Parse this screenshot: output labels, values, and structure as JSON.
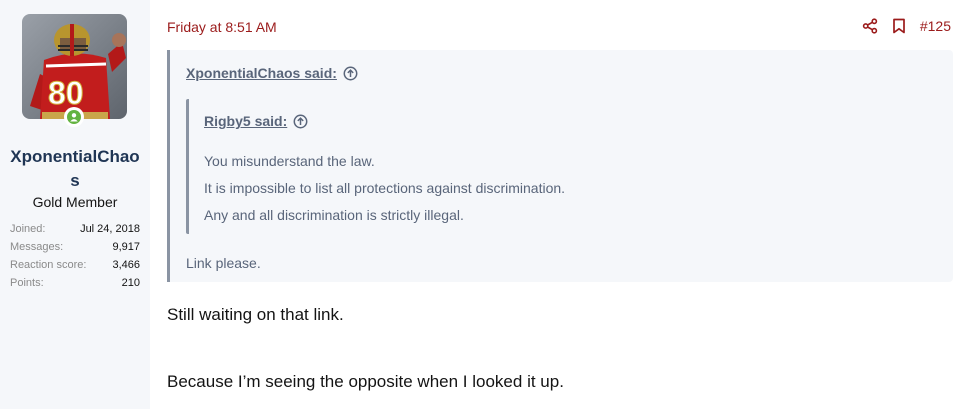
{
  "user": {
    "name": "XponentialChaos",
    "title": "Gold Member",
    "stats": [
      {
        "label": "Joined:",
        "value": "Jul 24, 2018"
      },
      {
        "label": "Messages:",
        "value": "9,917"
      },
      {
        "label": "Reaction score:",
        "value": "3,466"
      },
      {
        "label": "Points:",
        "value": "210"
      }
    ],
    "online_color": "#63b340"
  },
  "post": {
    "date": "Friday at 8:51 AM",
    "number": "#125",
    "accent_color": "#9b1b1b",
    "outer_quote": {
      "author_said": "XponentialChaos said:",
      "inner_quote": {
        "author_said": "Rigby5 said:",
        "lines": [
          "You misunderstand the law.",
          "It is impossible to list all protections against discrimination.",
          "Any and all discrimination is strictly illegal."
        ]
      },
      "tail": "Link please."
    },
    "body": [
      "Still waiting on that link.",
      "Because I’m seeing the opposite when I looked it up."
    ]
  },
  "icons": {
    "share": "share-icon",
    "bookmark": "bookmark-icon",
    "jump": "arrow-up-circle-icon",
    "online": "user-online-icon"
  }
}
